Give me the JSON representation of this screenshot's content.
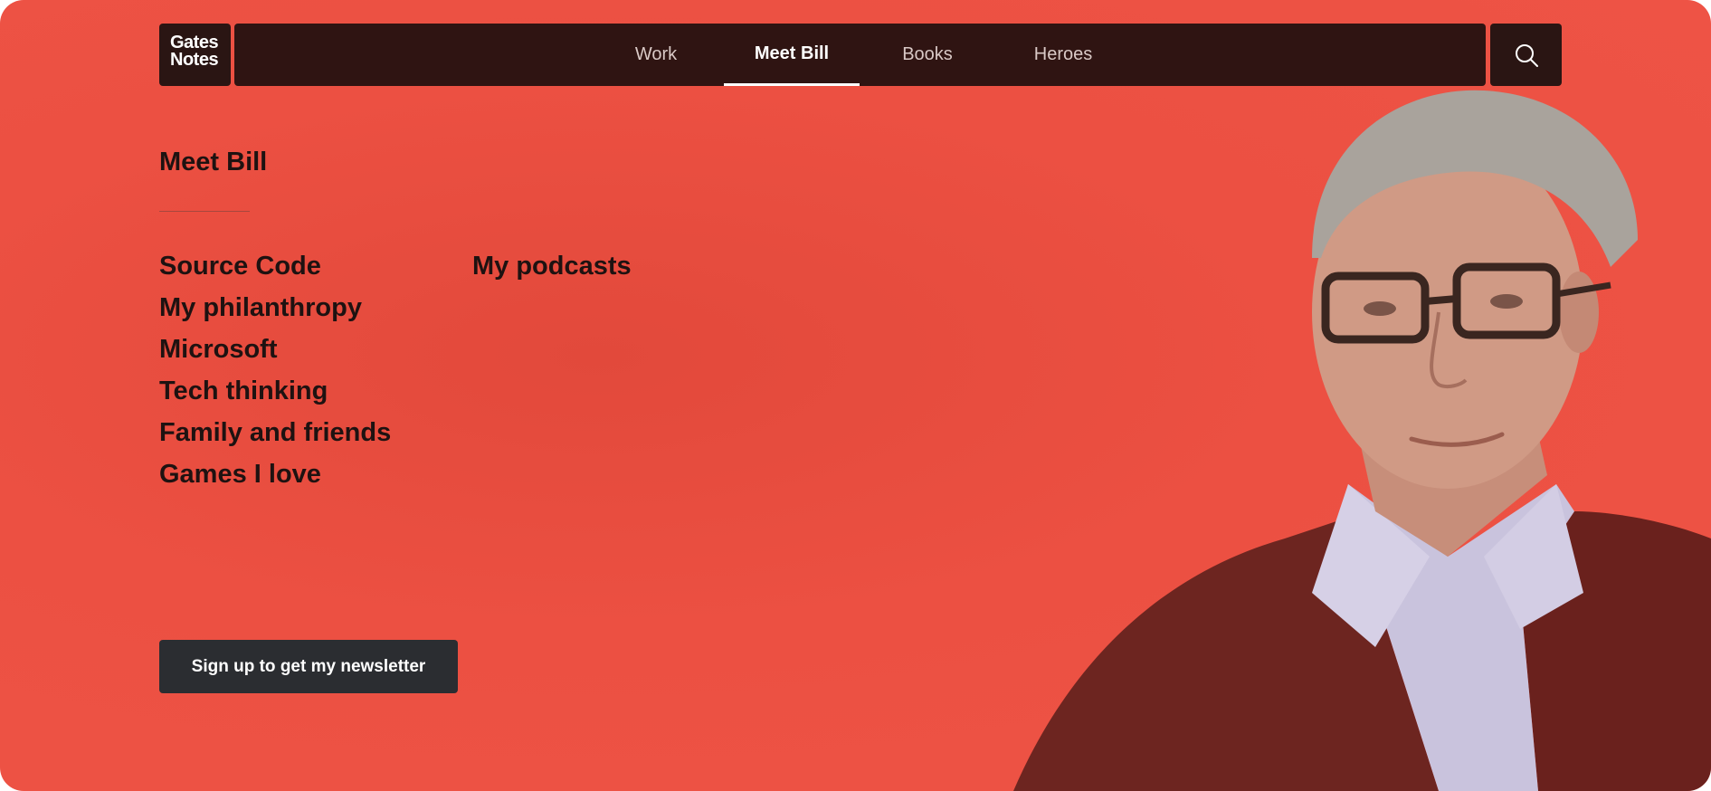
{
  "logo": {
    "line1": "Gates",
    "line2": "Notes"
  },
  "nav": {
    "items": [
      {
        "label": "Work",
        "active": false
      },
      {
        "label": "Meet Bill",
        "active": true
      },
      {
        "label": "Books",
        "active": false
      },
      {
        "label": "Heroes",
        "active": false
      }
    ],
    "search_icon": "search-icon"
  },
  "section": {
    "title": "Meet Bill",
    "column1": [
      "Source Code",
      "My philanthropy",
      "Microsoft",
      "Tech thinking",
      "Family and friends",
      "Games I love"
    ],
    "column2": [
      "My podcasts"
    ]
  },
  "newsletter": {
    "label": "Sign up to get my newsletter"
  },
  "colors": {
    "background": "#ee5446",
    "navbar": "#2f1412",
    "button": "#2b2d31",
    "text": "#1e1211"
  }
}
